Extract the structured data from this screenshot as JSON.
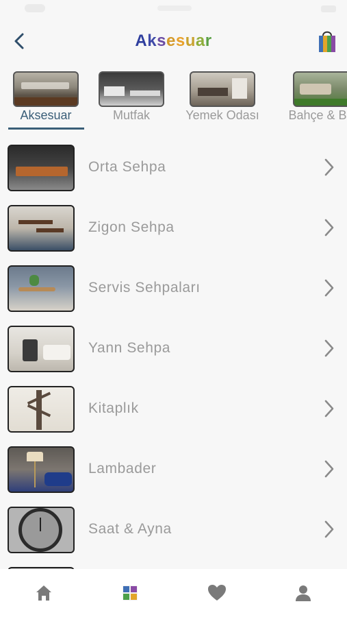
{
  "header": {
    "title": "Aksesuar",
    "title_colors": [
      "#2f3f9e",
      "#3f4aa8",
      "#6a4ba3",
      "#d49a2a",
      "#e8a12a",
      "#c9a330",
      "#8fae3a",
      "#5aa045"
    ],
    "back_icon": "chevron-left-icon",
    "cart_icon": "shopping-bag-icon"
  },
  "categories": [
    {
      "label": "Aksesuar",
      "active": true
    },
    {
      "label": "Mutfak",
      "active": false
    },
    {
      "label": "Yemek Odası",
      "active": false
    },
    {
      "label": "Bahçe & Ba",
      "active": false
    }
  ],
  "items": [
    {
      "label": "Orta Sehpa"
    },
    {
      "label": "Zigon Sehpa"
    },
    {
      "label": "Servis Sehpaları"
    },
    {
      "label": "Yann Sehpa"
    },
    {
      "label": "Kitaplık"
    },
    {
      "label": "Lambader"
    },
    {
      "label": "Saat & Ayna"
    }
  ],
  "tabbar": {
    "items": [
      {
        "name": "home-icon",
        "active": false
      },
      {
        "name": "categories-grid-icon",
        "active": true
      },
      {
        "name": "heart-icon",
        "active": false
      },
      {
        "name": "profile-icon",
        "active": false
      }
    ]
  },
  "colors": {
    "accent": "#3a5e78",
    "muted_text": "#9a9a9a",
    "background": "#f7f7f7"
  }
}
